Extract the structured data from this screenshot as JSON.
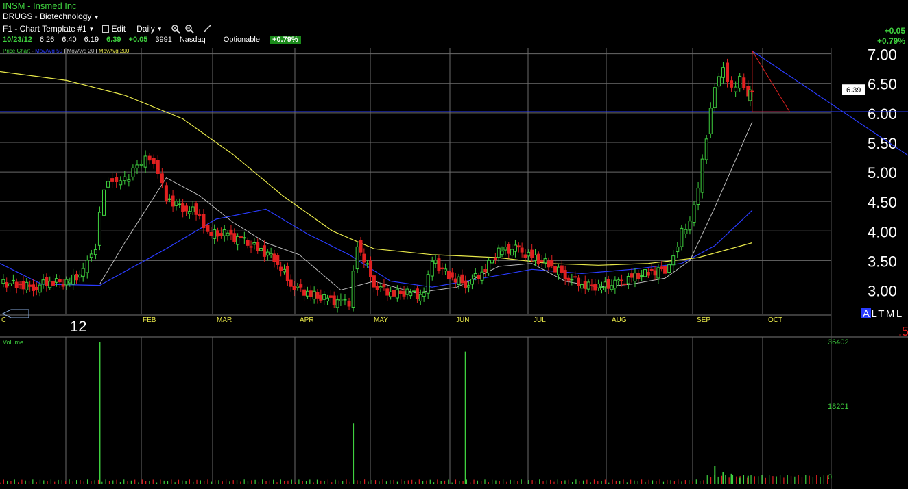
{
  "header": {
    "title": "INSM - Insmed Inc",
    "sector": "DRUGS - Biotechnology",
    "template_label": "F1 - Chart Template #1",
    "edit_label": "Edit",
    "period_label": "Daily"
  },
  "quote": {
    "date": "10/23/12",
    "open": "6.26",
    "high": "6.40",
    "low": "6.19",
    "last": "6.39",
    "change": "+0.05",
    "volume": "3991",
    "exchange": "Nasdaq",
    "optionable": "Optionable",
    "pct_change": "+0.79%"
  },
  "right_change": {
    "change": "+0.05",
    "pct": "+0.79%"
  },
  "legend": {
    "price": "Price Chart",
    "ma50": "MovAvg 50",
    "ma20": "MovAvg 20",
    "ma200": "MovAvg 200"
  },
  "volume_label": "Volume",
  "price_tag": "6.39",
  "year_label": "12",
  "left_partial_label": "C",
  "alt_label": "ALTML",
  "bottom_right_partial": ".5",
  "colors": {
    "up": "#3fd13f",
    "down": "#e02020",
    "ma50": "#2a3cff",
    "ma20": "#bdbdbd",
    "ma200": "#e8e84a",
    "grid": "#6a6a6a"
  },
  "chart_data": {
    "type": "candlestick",
    "symbol": "INSM",
    "period": "Daily",
    "ylim": [
      2.6,
      7.1
    ],
    "y_ticks": [
      3.0,
      3.5,
      4.0,
      4.5,
      5.0,
      5.5,
      6.0,
      6.5,
      7.0
    ],
    "y_tick_labels": [
      "3.00",
      "3.50",
      "4.00",
      "4.50",
      "5.00",
      "5.50",
      "6.00",
      "6.50",
      "7.00"
    ],
    "x_tick_labels": [
      "FEB",
      "MAR",
      "APR",
      "MAY",
      "JUN",
      "JUL",
      "AUG",
      "SEP",
      "OCT"
    ],
    "horizontal_line": 6.02,
    "resistance_line": [
      [
        0.905,
        7.05
      ],
      [
        1.0,
        5.28
      ]
    ],
    "triangle": [
      [
        0.905,
        7.05
      ],
      [
        0.905,
        6.02
      ],
      [
        0.95,
        6.02
      ]
    ],
    "last_price": 6.39,
    "price_points": [
      [
        0.0,
        3.12
      ],
      [
        0.02,
        3.1
      ],
      [
        0.04,
        3.05
      ],
      [
        0.06,
        3.15
      ],
      [
        0.08,
        3.12
      ],
      [
        0.1,
        3.3
      ],
      [
        0.115,
        3.75
      ],
      [
        0.125,
        4.75
      ],
      [
        0.135,
        4.9
      ],
      [
        0.15,
        4.85
      ],
      [
        0.165,
        5.1
      ],
      [
        0.18,
        5.25
      ],
      [
        0.19,
        4.95
      ],
      [
        0.2,
        4.55
      ],
      [
        0.22,
        4.4
      ],
      [
        0.24,
        4.3
      ],
      [
        0.25,
        3.95
      ],
      [
        0.27,
        3.95
      ],
      [
        0.29,
        3.85
      ],
      [
        0.31,
        3.7
      ],
      [
        0.33,
        3.55
      ],
      [
        0.35,
        3.1
      ],
      [
        0.37,
        2.95
      ],
      [
        0.39,
        2.85
      ],
      [
        0.41,
        2.8
      ],
      [
        0.42,
        2.75
      ],
      [
        0.43,
        3.8
      ],
      [
        0.45,
        3.1
      ],
      [
        0.47,
        2.95
      ],
      [
        0.49,
        2.95
      ],
      [
        0.51,
        2.9
      ],
      [
        0.52,
        3.5
      ],
      [
        0.54,
        3.25
      ],
      [
        0.56,
        3.1
      ],
      [
        0.58,
        3.3
      ],
      [
        0.6,
        3.65
      ],
      [
        0.62,
        3.7
      ],
      [
        0.64,
        3.55
      ],
      [
        0.66,
        3.45
      ],
      [
        0.68,
        3.25
      ],
      [
        0.7,
        3.1
      ],
      [
        0.72,
        3.05
      ],
      [
        0.74,
        3.1
      ],
      [
        0.76,
        3.2
      ],
      [
        0.78,
        3.3
      ],
      [
        0.8,
        3.35
      ],
      [
        0.81,
        3.6
      ],
      [
        0.82,
        4.0
      ],
      [
        0.83,
        4.1
      ],
      [
        0.84,
        4.7
      ],
      [
        0.85,
        5.6
      ],
      [
        0.86,
        6.5
      ],
      [
        0.87,
        6.8
      ],
      [
        0.88,
        6.4
      ],
      [
        0.89,
        6.55
      ],
      [
        0.9,
        6.25
      ],
      [
        0.905,
        6.39
      ]
    ],
    "series": [
      {
        "name": "MovAvg 50",
        "points": [
          [
            0.0,
            3.45
          ],
          [
            0.05,
            3.1
          ],
          [
            0.12,
            3.08
          ],
          [
            0.2,
            3.7
          ],
          [
            0.26,
            4.2
          ],
          [
            0.32,
            4.37
          ],
          [
            0.37,
            3.95
          ],
          [
            0.42,
            3.6
          ],
          [
            0.47,
            3.15
          ],
          [
            0.52,
            3.05
          ],
          [
            0.58,
            3.2
          ],
          [
            0.64,
            3.35
          ],
          [
            0.7,
            3.28
          ],
          [
            0.76,
            3.35
          ],
          [
            0.82,
            3.45
          ],
          [
            0.86,
            3.75
          ],
          [
            0.905,
            4.35
          ]
        ]
      },
      {
        "name": "MovAvg 20",
        "points": [
          [
            0.12,
            3.1
          ],
          [
            0.15,
            3.8
          ],
          [
            0.2,
            4.9
          ],
          [
            0.24,
            4.6
          ],
          [
            0.28,
            4.15
          ],
          [
            0.32,
            3.8
          ],
          [
            0.36,
            3.6
          ],
          [
            0.41,
            3.0
          ],
          [
            0.45,
            3.15
          ],
          [
            0.5,
            2.95
          ],
          [
            0.55,
            3.05
          ],
          [
            0.6,
            3.4
          ],
          [
            0.64,
            3.45
          ],
          [
            0.68,
            3.15
          ],
          [
            0.72,
            3.05
          ],
          [
            0.76,
            3.1
          ],
          [
            0.8,
            3.2
          ],
          [
            0.83,
            3.5
          ],
          [
            0.86,
            4.4
          ],
          [
            0.905,
            5.85
          ]
        ]
      },
      {
        "name": "MovAvg 200",
        "points": [
          [
            0.0,
            6.7
          ],
          [
            0.08,
            6.55
          ],
          [
            0.15,
            6.3
          ],
          [
            0.22,
            5.9
          ],
          [
            0.28,
            5.3
          ],
          [
            0.34,
            4.6
          ],
          [
            0.4,
            4.0
          ],
          [
            0.45,
            3.7
          ],
          [
            0.52,
            3.6
          ],
          [
            0.6,
            3.55
          ],
          [
            0.66,
            3.45
          ],
          [
            0.72,
            3.42
          ],
          [
            0.78,
            3.45
          ],
          [
            0.84,
            3.55
          ],
          [
            0.905,
            3.8
          ]
        ]
      }
    ],
    "volume": {
      "y_tick_labels": [
        "0",
        "18201",
        "36402"
      ],
      "ylim": [
        0,
        36402
      ],
      "spikes": [
        [
          0.12,
          36402
        ],
        [
          0.425,
          15500
        ],
        [
          0.56,
          34000
        ],
        [
          0.86,
          4500
        ],
        [
          0.87,
          3000
        ],
        [
          0.88,
          2500
        ],
        [
          0.89,
          1500
        ],
        [
          0.9,
          2000
        ]
      ],
      "base_level": 600
    }
  }
}
